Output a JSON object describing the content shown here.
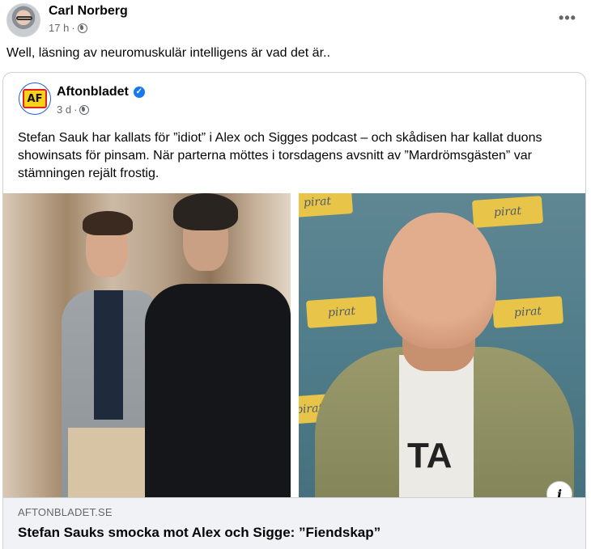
{
  "post": {
    "author": "Carl Norberg",
    "time": "17 h",
    "separator": "·",
    "privacy_icon": "globe-icon",
    "more_label": "•••",
    "text": "Well, läsning av neuromuskulär intelligens är vad det är.."
  },
  "shared": {
    "page_name": "Aftonbladet",
    "logo_text": "AF",
    "verified_icon": "verified-badge-icon",
    "verified_glyph": "✓",
    "time": "3 d",
    "separator": "·",
    "text": "Stefan Sauk har kallats för ”idiot” i Alex och Sigges podcast – och skådisen har kallat duons showinsats för pinsam. När parterna möttes i torsdagens avsnitt av ”Mardrömsgästen” var stämningen rejält frostig.",
    "image_left_text": [],
    "image_right_text": [
      "pirat",
      "pirat",
      "pirat",
      "pirat",
      "pirat",
      "TA"
    ],
    "info_label": "i",
    "link": {
      "domain": "AFTONBLADET.SE",
      "headline": "Stefan Sauks smocka mot Alex och Sigge: ”Fiendskap”"
    }
  },
  "colors": {
    "accent": "#1877f2",
    "secondary_text": "#65676b",
    "footer_bg": "#f0f2f5",
    "border": "#ced0d4"
  }
}
